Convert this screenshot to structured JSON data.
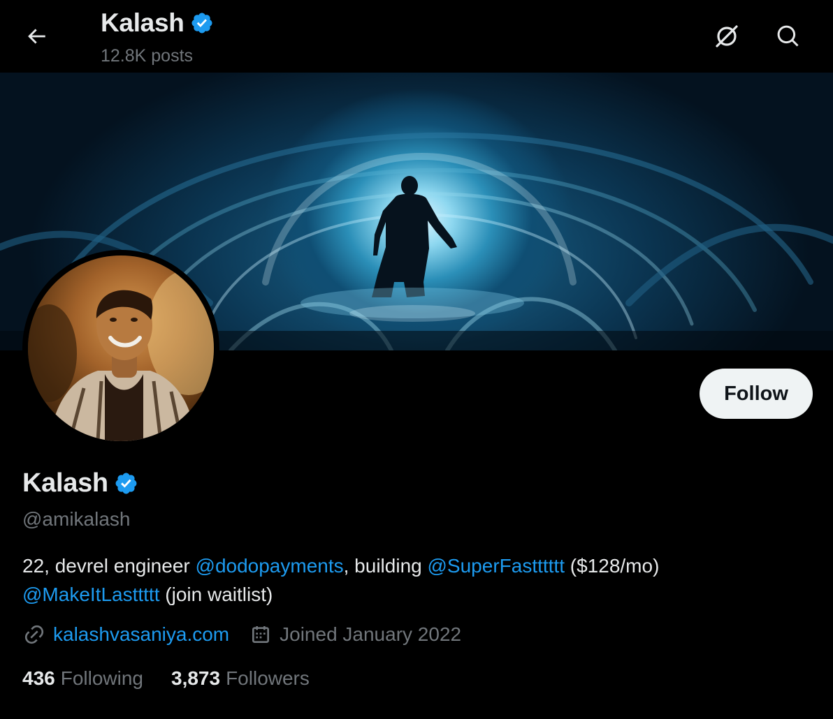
{
  "header": {
    "title": "Kalash",
    "posts_count": "12.8K posts",
    "back_icon": "arrow-left-icon",
    "grok_icon": "grok-icon",
    "search_icon": "search-icon"
  },
  "profile": {
    "name": "Kalash",
    "handle": "@amikalash",
    "verified": true,
    "follow_label": "Follow",
    "bio": {
      "t1": "22, devrel engineer ",
      "m1": "@dodopayments",
      "t2": ", building ",
      "m2": "@SuperFastttttt",
      "t3": " ($128/mo)",
      "m3": "@MakeItLasttttt",
      "t4": " (join waitlist)"
    },
    "website": "kalashvasaniya.com",
    "joined": "Joined January 2022",
    "following_count": "436",
    "following_label": "Following",
    "followers_count": "3,873",
    "followers_label": "Followers"
  },
  "colors": {
    "background": "#000000",
    "accent": "#1d9bf0",
    "text_primary": "#e7e9ea",
    "text_secondary": "#71767b",
    "follow_bg": "#eff3f4",
    "verified_badge": "#1d9bf0"
  }
}
